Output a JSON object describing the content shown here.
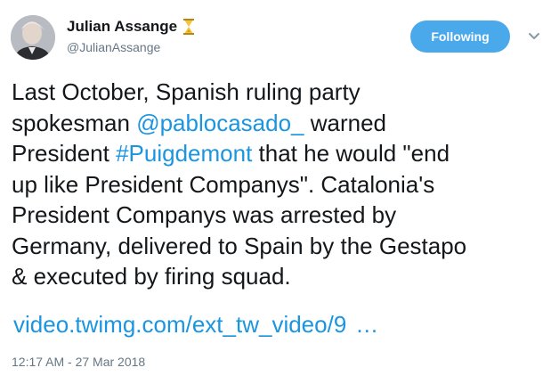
{
  "author": {
    "display_name": "Julian Assange",
    "handle": "@JulianAssange",
    "badge_icon": "hourglass-icon"
  },
  "follow_button": {
    "label": "Following"
  },
  "tweet": {
    "lines": {
      "l1": "Last October, Spanish ruling party",
      "l2_pre": "spokesman ",
      "l2_mention": "@pablocasado_",
      "l2_post": " warned",
      "l3_pre": "President ",
      "l3_hashtag": "#Puigdemont",
      "l3_post": " that he would \"end",
      "l4": "up like President Companys\". Catalonia's",
      "l5": "President Companys was arrested by",
      "l6": "Germany, delivered to Spain by the Gestapo",
      "l7": "& executed by firing squad."
    },
    "link_text": "video.twimg.com/ext_tw_video/9",
    "link_ellipsis": "…",
    "timestamp": "12:17 AM - 27 Mar 2018"
  },
  "colors": {
    "link": "#1b95e0",
    "button": "#4aa9eb",
    "secondary_text": "#657786"
  }
}
